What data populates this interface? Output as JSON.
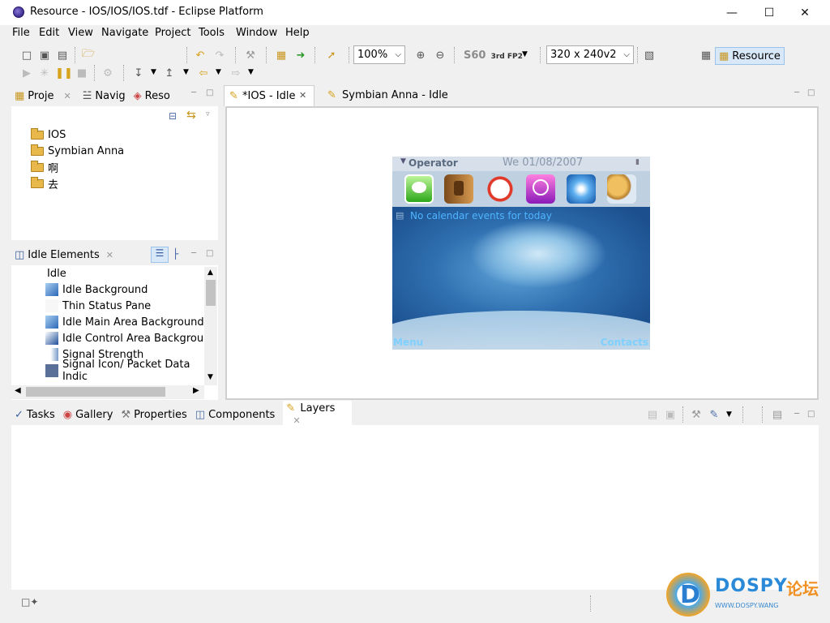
{
  "window": {
    "title": "Resource - IOS/IOS/IOS.tdf - Eclipse Platform",
    "minimize_glyph": "—",
    "maximize_glyph": "☐",
    "close_glyph": "✕"
  },
  "menu": [
    "File",
    "Edit",
    "View",
    "Navigate",
    "Project",
    "Tools",
    "Window",
    "Help"
  ],
  "toolbar": {
    "zoom_value": "100%",
    "platform_label": "S60",
    "platform_sub": "3rd FP2",
    "resolution_value": "320 x 240v2",
    "perspective_label": "Resource"
  },
  "left_top_pane": {
    "tabs": [
      "Proje",
      "Navig",
      "Reso"
    ],
    "tree": [
      "IOS",
      "Symbian Anna",
      "啊",
      "去"
    ]
  },
  "left_bottom_pane": {
    "tab": "Idle Elements",
    "root": "Idle",
    "items": [
      {
        "label": "Idle Background",
        "icon": "wallpaper-thumb-icon"
      },
      {
        "label": "Thin Status Pane",
        "icon": "blank-thumb-icon"
      },
      {
        "label": "Idle Main Area Background",
        "icon": "wallpaper-thumb-icon"
      },
      {
        "label": "Idle Control Area Background",
        "icon": "wallpaper-thumb-icon"
      },
      {
        "label": "Signal Strength",
        "icon": "signal-thumb-icon"
      },
      {
        "label": "Signal Icon/ Packet Data Indic",
        "icon": "signal-thumb-icon"
      }
    ]
  },
  "editor": {
    "tabs": [
      {
        "label": "*IOS - Idle",
        "active": true
      },
      {
        "label": "Symbian Anna - Idle",
        "active": false
      }
    ],
    "phone": {
      "operator": "Operator",
      "date": "We 01/08/2007",
      "note": "No calendar events for today",
      "left_softkey": "Menu",
      "right_softkey": "Contacts",
      "apps": [
        "messages-app-icon",
        "contacts-app-icon",
        "clock-app-icon",
        "music-app-icon",
        "safari-app-icon",
        "mail-app-icon"
      ]
    }
  },
  "bottom_pane": {
    "tabs": [
      "Tasks",
      "Gallery",
      "Properties",
      "Components",
      "Layers"
    ],
    "active_tab": "Layers"
  },
  "watermark": {
    "brand": "DOSPY",
    "brand_cn": "论坛",
    "url": "WWW.DOSPY.WANG"
  },
  "colors": {
    "accent_selected": "#d9e8f8",
    "chrome": "#f0f0f0",
    "softkey_text": "#7fd0ff"
  }
}
